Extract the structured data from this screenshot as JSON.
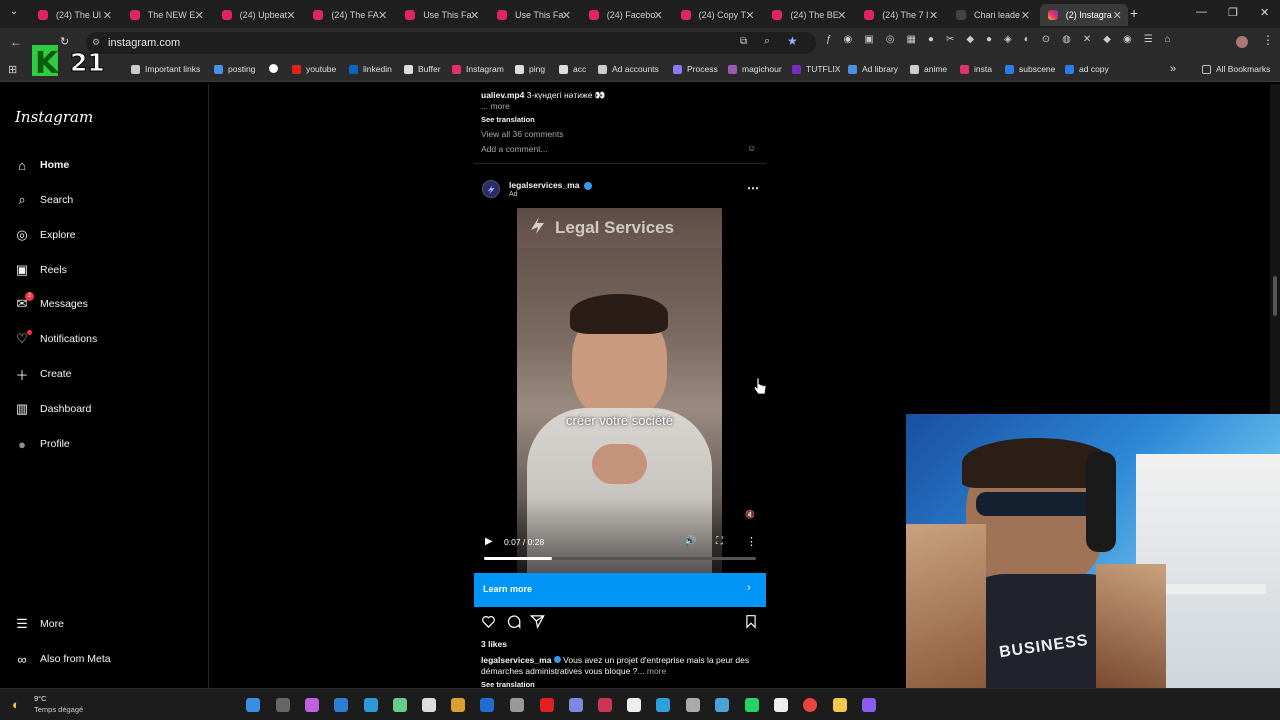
{
  "browser": {
    "tabs": [
      {
        "title": "(24) The Ul",
        "icon": "youtube-icon"
      },
      {
        "title": "The NEW E",
        "icon": "youtube-icon"
      },
      {
        "title": "(24) Upbeat",
        "icon": "youtube-icon"
      },
      {
        "title": "(24) The FA",
        "icon": "youtube-icon"
      },
      {
        "title": "Use This Fa",
        "icon": "youtube-icon"
      },
      {
        "title": "Use This Fa",
        "icon": "youtube-icon"
      },
      {
        "title": "(24) Facebo",
        "icon": "youtube-icon"
      },
      {
        "title": "(24) Copy T",
        "icon": "youtube-icon"
      },
      {
        "title": "(24) The BE",
        "icon": "youtube-icon"
      },
      {
        "title": "(24) The 7 I",
        "icon": "youtube-icon"
      },
      {
        "title": "Chari leade",
        "icon": "page-icon"
      },
      {
        "title": "(2) Instagra",
        "icon": "instagram-icon",
        "active": true
      }
    ],
    "url": "instagram.com",
    "bookmarks": [
      "Important links",
      "posting",
      "",
      "youtube",
      "linkedin",
      "Buffer",
      "Instagram",
      "ping",
      "acc",
      "Ad accounts",
      "Process",
      "magichour",
      "TUTFLIX",
      "Ad library",
      "anime",
      "insta",
      "subscene",
      "ad copy"
    ],
    "all_bookmarks": "All Bookmarks",
    "overflow": "»"
  },
  "overlay_logo": "K 21",
  "sidebar": {
    "logo": "Instagram",
    "items": [
      {
        "label": "Home",
        "icon": "home-icon"
      },
      {
        "label": "Search",
        "icon": "search-icon"
      },
      {
        "label": "Explore",
        "icon": "compass-icon"
      },
      {
        "label": "Reels",
        "icon": "reels-icon"
      },
      {
        "label": "Messages",
        "icon": "messenger-icon",
        "badge": "2"
      },
      {
        "label": "Notifications",
        "icon": "heart-icon"
      },
      {
        "label": "Create",
        "icon": "plus-icon"
      },
      {
        "label": "Dashboard",
        "icon": "dashboard-icon"
      },
      {
        "label": "Profile",
        "icon": "avatar-icon"
      }
    ],
    "bottom": [
      {
        "label": "More",
        "icon": "hamburger-icon"
      },
      {
        "label": "Also from Meta",
        "icon": "meta-icon"
      }
    ]
  },
  "prev_post": {
    "caption_user": "ualiev.mp4",
    "caption_text": "3-күндегі нәтиже 👀",
    "more": "... more",
    "see_translation": "See translation",
    "view_comments": "View all 36 comments",
    "add_comment": "Add a comment..."
  },
  "post": {
    "username": "legalservices_ma",
    "sponsored": "Ad",
    "video_overlay_title": "Legal Services",
    "video_caption": "créer votre société",
    "time": "0:07 / 0:28",
    "progress": 0.25,
    "cta": "Learn more",
    "likes": "3 likes",
    "caption_user": "legalservices_ma",
    "caption_text": "Vous avez un projet d'entreprise mais la peur des démarches administratives vous bloque ?...",
    "caption_more": "more",
    "see_translation": "See translation"
  },
  "taskbar": {
    "temp": "9°C",
    "weather": "Temps dégagé"
  },
  "webcam_shirt": "BUSINESS"
}
